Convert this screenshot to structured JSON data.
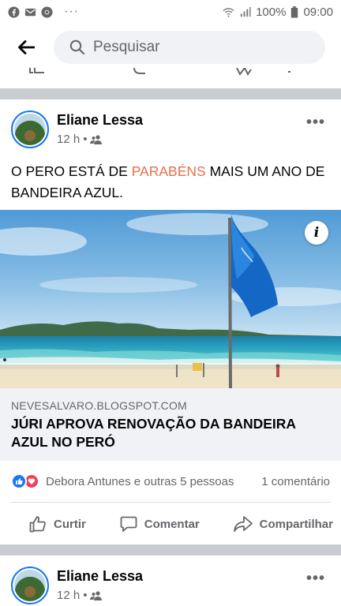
{
  "status_bar": {
    "battery": "100%",
    "time": "09:00",
    "overflow": "···",
    "icons": [
      "facebook-icon",
      "mail-icon",
      "chrome-icon",
      "wifi-icon",
      "signal-icon",
      "battery-icon"
    ]
  },
  "top_bar": {
    "back_icon": "arrow-left-icon",
    "search_placeholder": "Pesquisar"
  },
  "posts": [
    {
      "author": "Eliane Lessa",
      "time": "12 h",
      "dot": "•",
      "audience_icon": "friends-icon",
      "more": "•••",
      "text_before": "O PERO ESTÁ DE ",
      "text_highlight": "PARABÉNS",
      "text_after": " MAIS UM ANO DE BANDEIRA AZUL.",
      "image_info_icon": "i",
      "link": {
        "domain": "NEVESALVARO.BLOGSPOT.COM",
        "title": "JÚRI APROVA RENOVAÇÃO DA BANDEIRA AZUL NO PERÓ"
      },
      "reactions": {
        "summary": "Debora Antunes e outras 5 pessoas",
        "comments": "1 comentário",
        "types": [
          "like",
          "love"
        ]
      },
      "actions": {
        "like": "Curtir",
        "comment": "Comentar",
        "share": "Compartilhar"
      }
    },
    {
      "author": "Eliane Lessa",
      "time": "12 h",
      "dot": "•",
      "audience_icon": "friends-icon",
      "more": "•••"
    }
  ],
  "colors": {
    "accent": "#1877f2",
    "highlight_text": "#e4704c",
    "love": "#f33e58",
    "separator": "#c9ccd1",
    "link_bg": "#f0f2f5"
  }
}
